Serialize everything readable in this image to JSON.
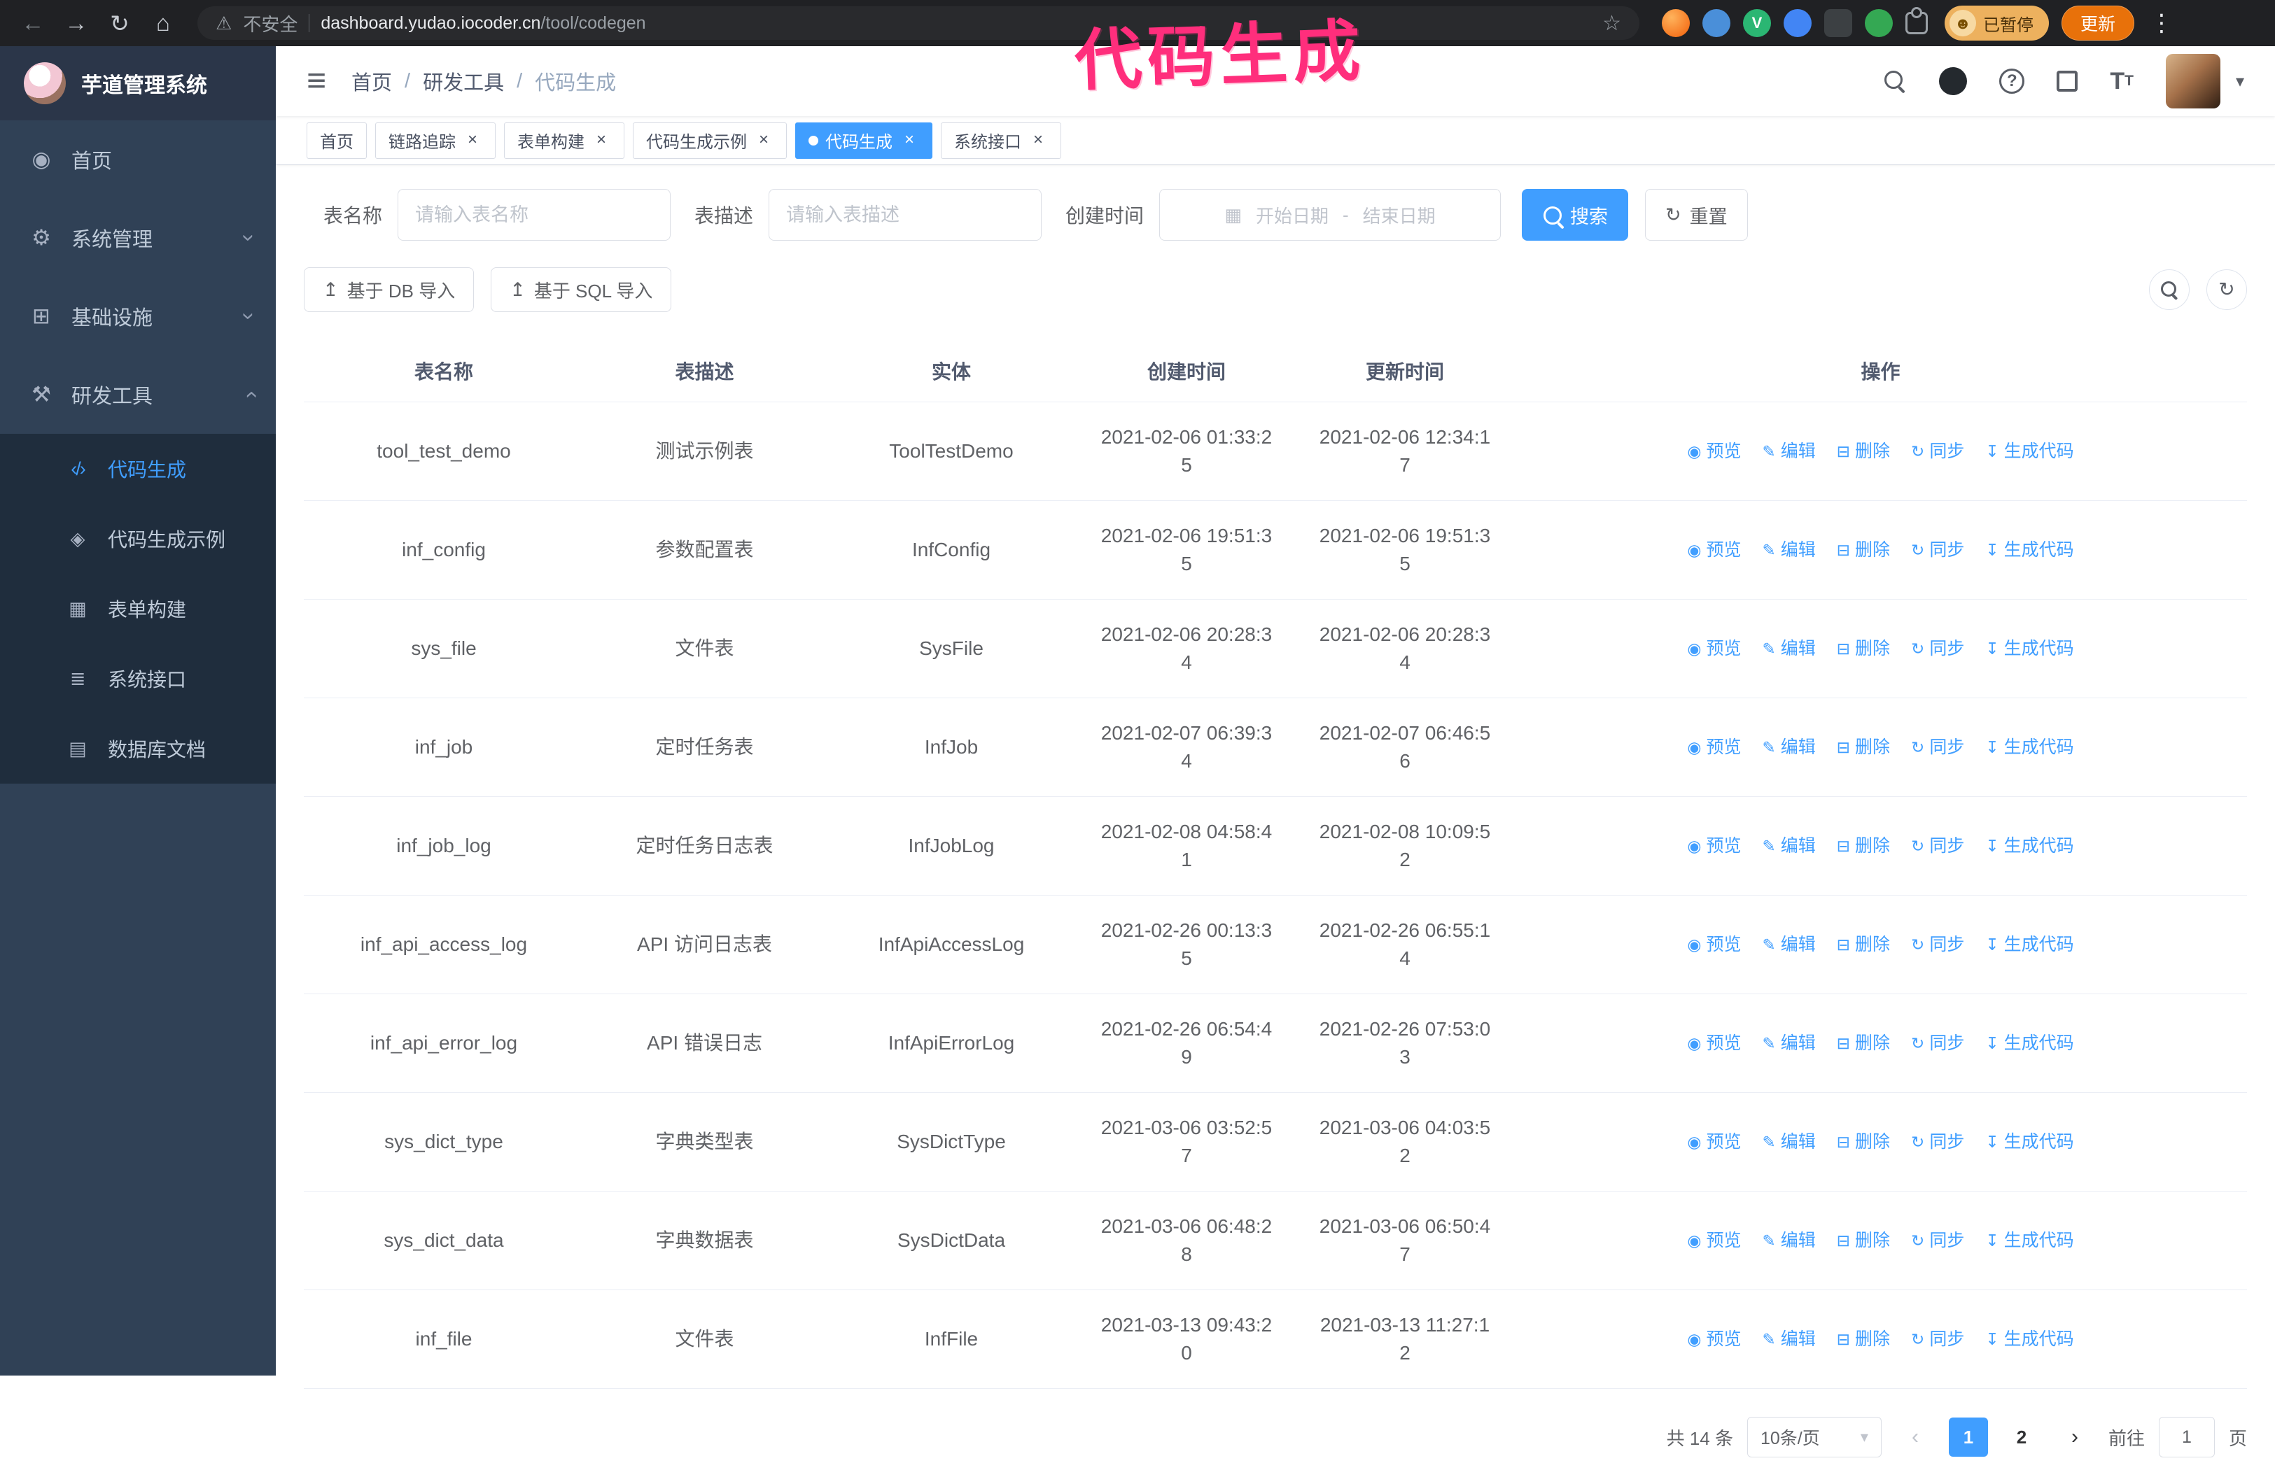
{
  "annotation": {
    "text": "代码生成",
    "color": "#ff2e7c"
  },
  "browser": {
    "security_label": "不安全",
    "url": {
      "domain": "dashboard.yudao.iocoder.cn",
      "path": "/tool/codegen"
    },
    "profile_chip": "已暂停",
    "update_button": "更新"
  },
  "sidebar": {
    "title": "芋道管理系统",
    "items": [
      {
        "label": "首页"
      },
      {
        "label": "系统管理"
      },
      {
        "label": "基础设施"
      },
      {
        "label": "研发工具"
      }
    ],
    "subitems": [
      {
        "label": "代码生成"
      },
      {
        "label": "代码生成示例"
      },
      {
        "label": "表单构建"
      },
      {
        "label": "系统接口"
      },
      {
        "label": "数据库文档"
      }
    ]
  },
  "breadcrumb": {
    "items": [
      "首页",
      "研发工具",
      "代码生成"
    ],
    "separator": "/"
  },
  "tabs": [
    {
      "label": "首页",
      "closable": false,
      "active": false
    },
    {
      "label": "链路追踪",
      "closable": true,
      "active": false
    },
    {
      "label": "表单构建",
      "closable": true,
      "active": false
    },
    {
      "label": "代码生成示例",
      "closable": true,
      "active": false
    },
    {
      "label": "代码生成",
      "closable": true,
      "active": true
    },
    {
      "label": "系统接口",
      "closable": true,
      "active": false
    }
  ],
  "filters": {
    "table_name_label": "表名称",
    "table_name_placeholder": "请输入表名称",
    "table_desc_label": "表描述",
    "table_desc_placeholder": "请输入表描述",
    "create_time_label": "创建时间",
    "date_start_placeholder": "开始日期",
    "date_separator": "-",
    "date_end_placeholder": "结束日期",
    "search_button": "搜索",
    "reset_button": "重置"
  },
  "toolbar": {
    "import_db_button": "基于 DB 导入",
    "import_sql_button": "基于 SQL 导入"
  },
  "table": {
    "columns": [
      "表名称",
      "表描述",
      "实体",
      "创建时间",
      "更新时间",
      "操作"
    ],
    "actions": [
      "预览",
      "编辑",
      "删除",
      "同步",
      "生成代码"
    ],
    "rows": [
      {
        "name": "tool_test_demo",
        "desc": "测试示例表",
        "entity": "ToolTestDemo",
        "created": "2021-02-06 01:33:25",
        "updated": "2021-02-06 12:34:17"
      },
      {
        "name": "inf_config",
        "desc": "参数配置表",
        "entity": "InfConfig",
        "created": "2021-02-06 19:51:35",
        "updated": "2021-02-06 19:51:35"
      },
      {
        "name": "sys_file",
        "desc": "文件表",
        "entity": "SysFile",
        "created": "2021-02-06 20:28:34",
        "updated": "2021-02-06 20:28:34"
      },
      {
        "name": "inf_job",
        "desc": "定时任务表",
        "entity": "InfJob",
        "created": "2021-02-07 06:39:34",
        "updated": "2021-02-07 06:46:56"
      },
      {
        "name": "inf_job_log",
        "desc": "定时任务日志表",
        "entity": "InfJobLog",
        "created": "2021-02-08 04:58:41",
        "updated": "2021-02-08 10:09:52"
      },
      {
        "name": "inf_api_access_log",
        "desc": "API 访问日志表",
        "entity": "InfApiAccessLog",
        "created": "2021-02-26 00:13:35",
        "updated": "2021-02-26 06:55:14"
      },
      {
        "name": "inf_api_error_log",
        "desc": "API 错误日志",
        "entity": "InfApiErrorLog",
        "created": "2021-02-26 06:54:49",
        "updated": "2021-02-26 07:53:03"
      },
      {
        "name": "sys_dict_type",
        "desc": "字典类型表",
        "entity": "SysDictType",
        "created": "2021-03-06 03:52:57",
        "updated": "2021-03-06 04:03:52"
      },
      {
        "name": "sys_dict_data",
        "desc": "字典数据表",
        "entity": "SysDictData",
        "created": "2021-03-06 06:48:28",
        "updated": "2021-03-06 06:50:47"
      },
      {
        "name": "inf_file",
        "desc": "文件表",
        "entity": "InfFile",
        "created": "2021-03-13 09:43:20",
        "updated": "2021-03-13 11:27:12"
      }
    ]
  },
  "pagination": {
    "total": "共 14 条",
    "page_size": "10条/页",
    "pages": [
      "1",
      "2"
    ],
    "active_page": "1",
    "goto_label": "前往",
    "goto_value": "1",
    "goto_suffix": "页"
  },
  "colors": {
    "primary": "#409eff",
    "sidebar_bg": "#304156",
    "submenu_bg": "#1f2d3d"
  },
  "icons": {
    "back": "←",
    "forward": "→",
    "reload": "↻",
    "home": "⌂",
    "warning": "⚠",
    "star": "☆",
    "dots": "⋮",
    "hamburger": "≡",
    "caret_down": "▾",
    "chevron": "›",
    "menu_home": "◉",
    "menu_system": "⚙",
    "menu_infra": "⊞",
    "menu_tools": "⚒",
    "sub_codegen": "‹/›",
    "sub_example": "◈",
    "sub_form": "▦",
    "sub_api": "≣",
    "sub_dbdoc": "▤",
    "calendar": "▦",
    "upload": "↥",
    "reset": "↻",
    "refresh": "↻",
    "eye": "◉",
    "edit": "✎",
    "trash": "⊟",
    "sync": "↻",
    "download": "↧",
    "prev": "‹",
    "next": "›",
    "font_size_large": "T",
    "font_size_small": "T",
    "question": "?"
  }
}
